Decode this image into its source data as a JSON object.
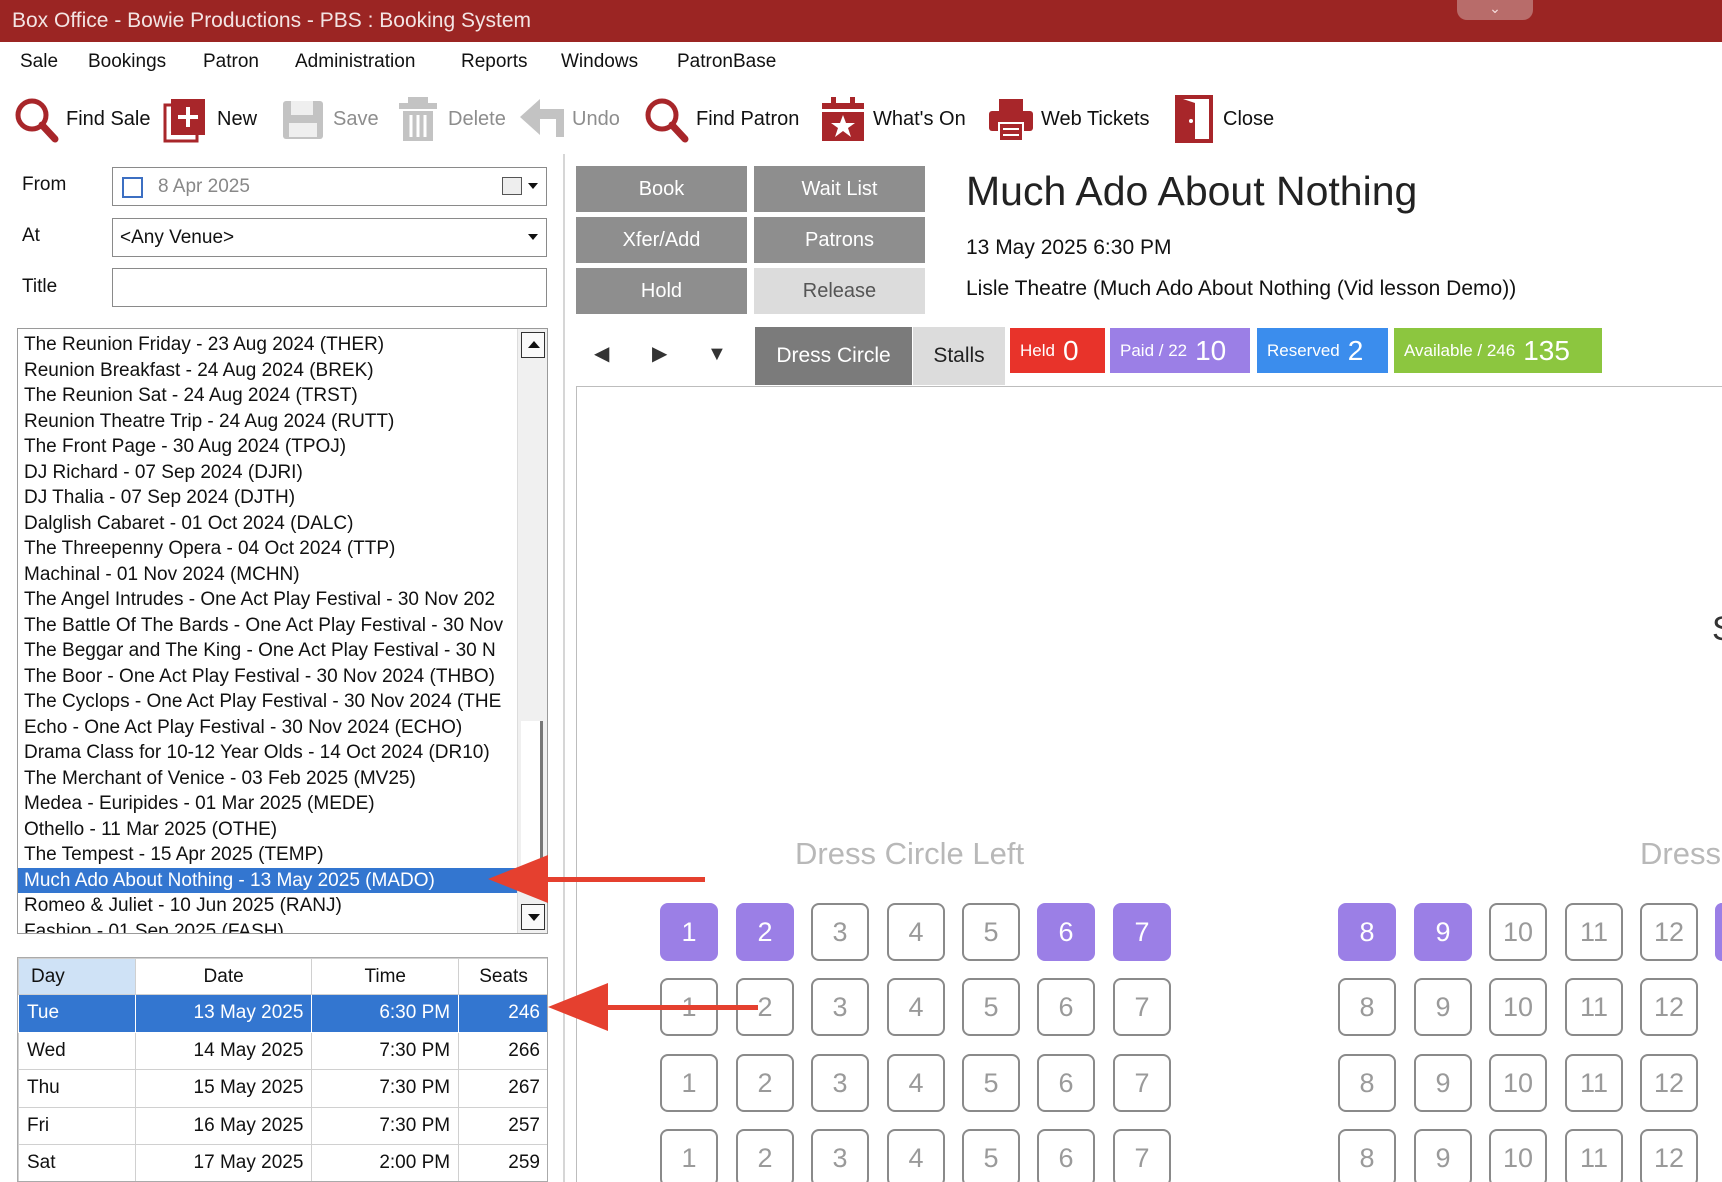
{
  "window": {
    "title": "Box Office - Bowie Productions - PBS : Booking System"
  },
  "menu": [
    "Sale",
    "Bookings",
    "Patron",
    "Administration",
    "Reports",
    "Windows",
    "PatronBase"
  ],
  "toolbar": {
    "find_sale": "Find Sale",
    "new": "New",
    "save": "Save",
    "delete": "Delete",
    "undo": "Undo",
    "find_patron": "Find Patron",
    "whats_on": "What's On",
    "web_tickets": "Web Tickets",
    "close": "Close"
  },
  "filters": {
    "from_label": "From",
    "from_value": "8 Apr 2025",
    "at_label": "At",
    "at_value": "<Any Venue>",
    "title_label": "Title",
    "title_value": ""
  },
  "event_list": [
    "The Reunion Friday - 23 Aug 2024 (THER)",
    "Reunion Breakfast - 24 Aug 2024 (BREK)",
    "The Reunion Sat - 24 Aug 2024 (TRST)",
    "Reunion Theatre Trip - 24 Aug 2024 (RUTT)",
    "The Front Page - 30 Aug 2024 (TPOJ)",
    "DJ Richard - 07 Sep 2024 (DJRI)",
    "DJ Thalia  - 07 Sep 2024 (DJTH)",
    "Dalglish Cabaret - 01 Oct 2024 (DALC)",
    "The Threepenny Opera  - 04 Oct 2024 (TTP)",
    "Machinal  - 01 Nov 2024 (MCHN)",
    "The Angel Intrudes - One Act Play Festival - 30 Nov 202",
    "The Battle Of The Bards - One Act Play Festival - 30 Nov",
    "The Beggar and The King - One Act Play Festival - 30 N",
    "The Boor - One Act Play Festival - 30 Nov 2024 (THBO)",
    "The Cyclops - One Act Play Festival - 30 Nov 2024 (THE",
    "Echo - One Act Play Festival - 30 Nov 2024 (ECHO)",
    "Drama Class for 10-12 Year Olds - 14 Oct 2024 (DR10)",
    "The Merchant of Venice - 03 Feb 2025 (MV25)",
    "Medea - Euripides - 01 Mar 2025 (MEDE)",
    "Othello - 11 Mar 2025 (OTHE)",
    "The Tempest - 15 Apr 2025 (TEMP)",
    "Much Ado About Nothing - 13 May 2025 (MADO)",
    "Romeo & Juliet - 10 Jun 2025 (RANJ)",
    "Fashion  - 01 Sep 2025 (FASH)"
  ],
  "performances": {
    "headers": [
      "Day",
      "Date",
      "Time",
      "Seats"
    ],
    "rows": [
      [
        "Tue",
        "13 May 2025",
        "6:30 PM",
        "246"
      ],
      [
        "Wed",
        "14 May 2025",
        "7:30 PM",
        "266"
      ],
      [
        "Thu",
        "15 May 2025",
        "7:30 PM",
        "267"
      ],
      [
        "Fri",
        "16 May 2025",
        "7:30 PM",
        "257"
      ],
      [
        "Sat",
        "17 May 2025",
        "2:00 PM",
        "259"
      ]
    ]
  },
  "actions": {
    "book": "Book",
    "wait_list": "Wait List",
    "xfer_add": "Xfer/Add",
    "patrons": "Patrons",
    "hold": "Hold",
    "release": "Release"
  },
  "show": {
    "title": "Much Ado About Nothing",
    "datetime": "13 May 2025 6:30 PM",
    "venue": "Lisle Theatre (Much Ado About Nothing (Vid lesson Demo))"
  },
  "tabs": {
    "dress_circle": "Dress Circle",
    "stalls": "Stalls"
  },
  "stats": {
    "held_label": "Held",
    "held_value": "0",
    "paid_label": "Paid / 22",
    "paid_value": "10",
    "reserved_label": "Reserved",
    "reserved_value": "2",
    "available_label": "Available / 246",
    "available_value": "135"
  },
  "seating": {
    "section_left": "Dress Circle Left",
    "section_right": "Dress",
    "edge_char": "S",
    "left_seats": [
      "1",
      "2",
      "3",
      "4",
      "5",
      "6",
      "7"
    ],
    "right_seats": [
      "8",
      "9",
      "10",
      "11",
      "12"
    ]
  },
  "colors": {
    "titlebar": "#9b2523",
    "held": "#e8332a",
    "paid": "#9b7fe6",
    "reserved": "#3b8ded",
    "available": "#8cc63f",
    "selection": "#3376d0",
    "annotation_arrow": "#e5402f"
  }
}
